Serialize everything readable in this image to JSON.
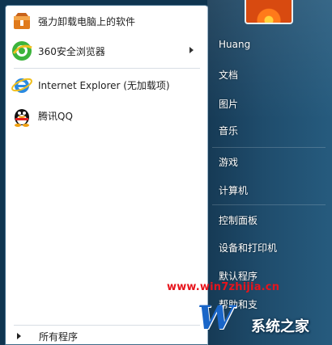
{
  "left_pane": {
    "programs": [
      {
        "label": "强力卸载电脑上的软件",
        "icon": "uninstaller-box-icon",
        "has_submenu": false
      },
      {
        "label": "360安全浏览器",
        "icon": "360-browser-icon",
        "has_submenu": true
      },
      {
        "label": "Internet Explorer (无加载项)",
        "icon": "internet-explorer-icon",
        "has_submenu": false
      },
      {
        "label": "腾讯QQ",
        "icon": "qq-penguin-icon",
        "has_submenu": false
      }
    ],
    "all_programs_label": "所有程序"
  },
  "right_pane": {
    "user_name": "Huang",
    "items": [
      "文档",
      "图片",
      "音乐",
      "游戏",
      "计算机",
      "控制面板",
      "设备和打印机",
      "默认程序",
      "帮助和支"
    ]
  },
  "watermark": {
    "url": "www.win7zhijia.cn",
    "site_name": "系统之家"
  },
  "colors": {
    "right_pane_bg": "#1f4c6c",
    "left_pane_bg": "#ffffff",
    "watermark_red": "#e8141c"
  }
}
